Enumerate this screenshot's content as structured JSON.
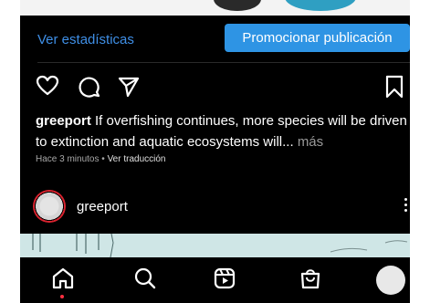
{
  "insights": {
    "stats_link": "Ver estadísticas",
    "promote_button": "Promocionar publicación"
  },
  "caption": {
    "username": "greeport",
    "text": "If overfishing continues, more species will be driven to extinction and aquatic ecosystems will...",
    "more": "más"
  },
  "meta": {
    "time": "Hace 3 minutos",
    "separator": "•",
    "translate": "Ver traducción"
  },
  "post": {
    "username": "greeport"
  },
  "icons": {
    "like": "heart-icon",
    "comment": "comment-icon",
    "share": "send-icon",
    "save": "bookmark-icon",
    "nav": [
      "home-icon",
      "search-icon",
      "reels-icon",
      "shop-icon"
    ]
  },
  "colors": {
    "link": "#3f8fe6",
    "button": "#2e94e4",
    "notification_dot": "#ff3040"
  }
}
